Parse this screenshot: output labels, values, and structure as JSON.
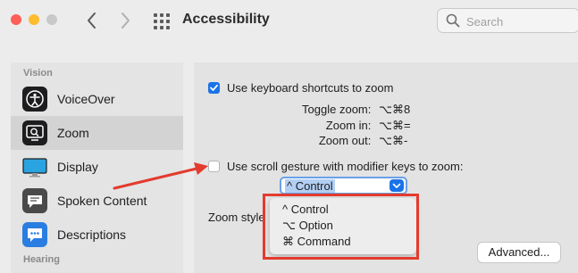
{
  "window": {
    "title": "Accessibility"
  },
  "traffic_lights": [
    {
      "name": "close",
      "color": "#fe5f57"
    },
    {
      "name": "minimize",
      "color": "#febc2e"
    },
    {
      "name": "zoom",
      "color": "#c8c8c8"
    }
  ],
  "search": {
    "placeholder": "Search"
  },
  "sidebar": {
    "heading_vision": "Vision",
    "heading_hearing": "Hearing",
    "items": [
      {
        "label": "VoiceOver",
        "icon": "voiceover-icon"
      },
      {
        "label": "Zoom",
        "icon": "zoom-icon",
        "selected": true
      },
      {
        "label": "Display",
        "icon": "display-icon"
      },
      {
        "label": "Spoken Content",
        "icon": "spoken-content-icon"
      },
      {
        "label": "Descriptions",
        "icon": "descriptions-icon"
      }
    ]
  },
  "main": {
    "keyboard_shortcuts": {
      "label": "Use keyboard shortcuts to zoom",
      "checked": true
    },
    "shortcuts": [
      {
        "label": "Toggle zoom:",
        "keys": "⌥⌘8"
      },
      {
        "label": "Zoom in:",
        "keys": "⌥⌘="
      },
      {
        "label": "Zoom out:",
        "keys": "⌥⌘-"
      }
    ],
    "scroll_gesture": {
      "label": "Use scroll gesture with modifier keys to zoom:",
      "checked": false
    },
    "modifier_popup": {
      "value": "^ Control"
    },
    "modifier_options": [
      "^ Control",
      "⌥ Option",
      "⌘ Command"
    ],
    "zoom_style_label": "Zoom style",
    "advanced_button": "Advanced..."
  },
  "annotation": {
    "arrow_color": "#e33b2e",
    "box_color": "#e33b2e"
  }
}
